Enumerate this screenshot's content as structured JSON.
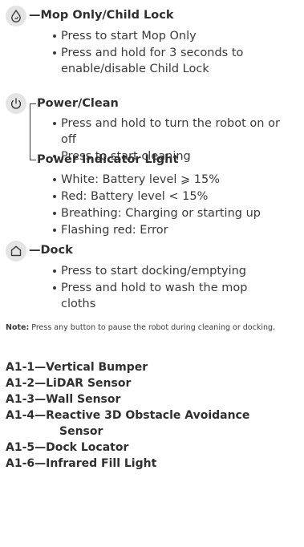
{
  "mop_section": {
    "heading": "—Mop Only/Child Lock",
    "icon": "droplet-icon",
    "bullets": [
      "Press to start Mop Only",
      "Press and hold for 3 seconds to enable/disable Child Lock"
    ]
  },
  "power_section": {
    "heading": "Power/Clean",
    "icon": "power-icon",
    "bullets": [
      "Press and hold to turn the robot on or off",
      "Press to start cleaning"
    ]
  },
  "indicator_section": {
    "heading": "Power Indicator Light",
    "bullets": [
      "White: Battery level ⩾ 15%",
      "Red: Battery level < 15%",
      "Breathing: Charging or starting up",
      "Flashing red: Error"
    ]
  },
  "dock_section": {
    "heading": "—Dock",
    "icon": "house-icon",
    "bullets": [
      "Press to start docking/emptying",
      "Press and hold to wash the mop cloths"
    ]
  },
  "note": {
    "label": "Note:",
    "text": " Press any button to pause the robot during cleaning or docking."
  },
  "parts": [
    "A1-1—Vertical Bumper",
    "A1-2—LiDAR Sensor",
    "A1-3—Wall Sensor",
    "A1-4—Reactive 3D Obstacle Avoidance",
    "Sensor",
    "A1-5—Dock Locator",
    "A1-6—Infrared Fill Light"
  ]
}
